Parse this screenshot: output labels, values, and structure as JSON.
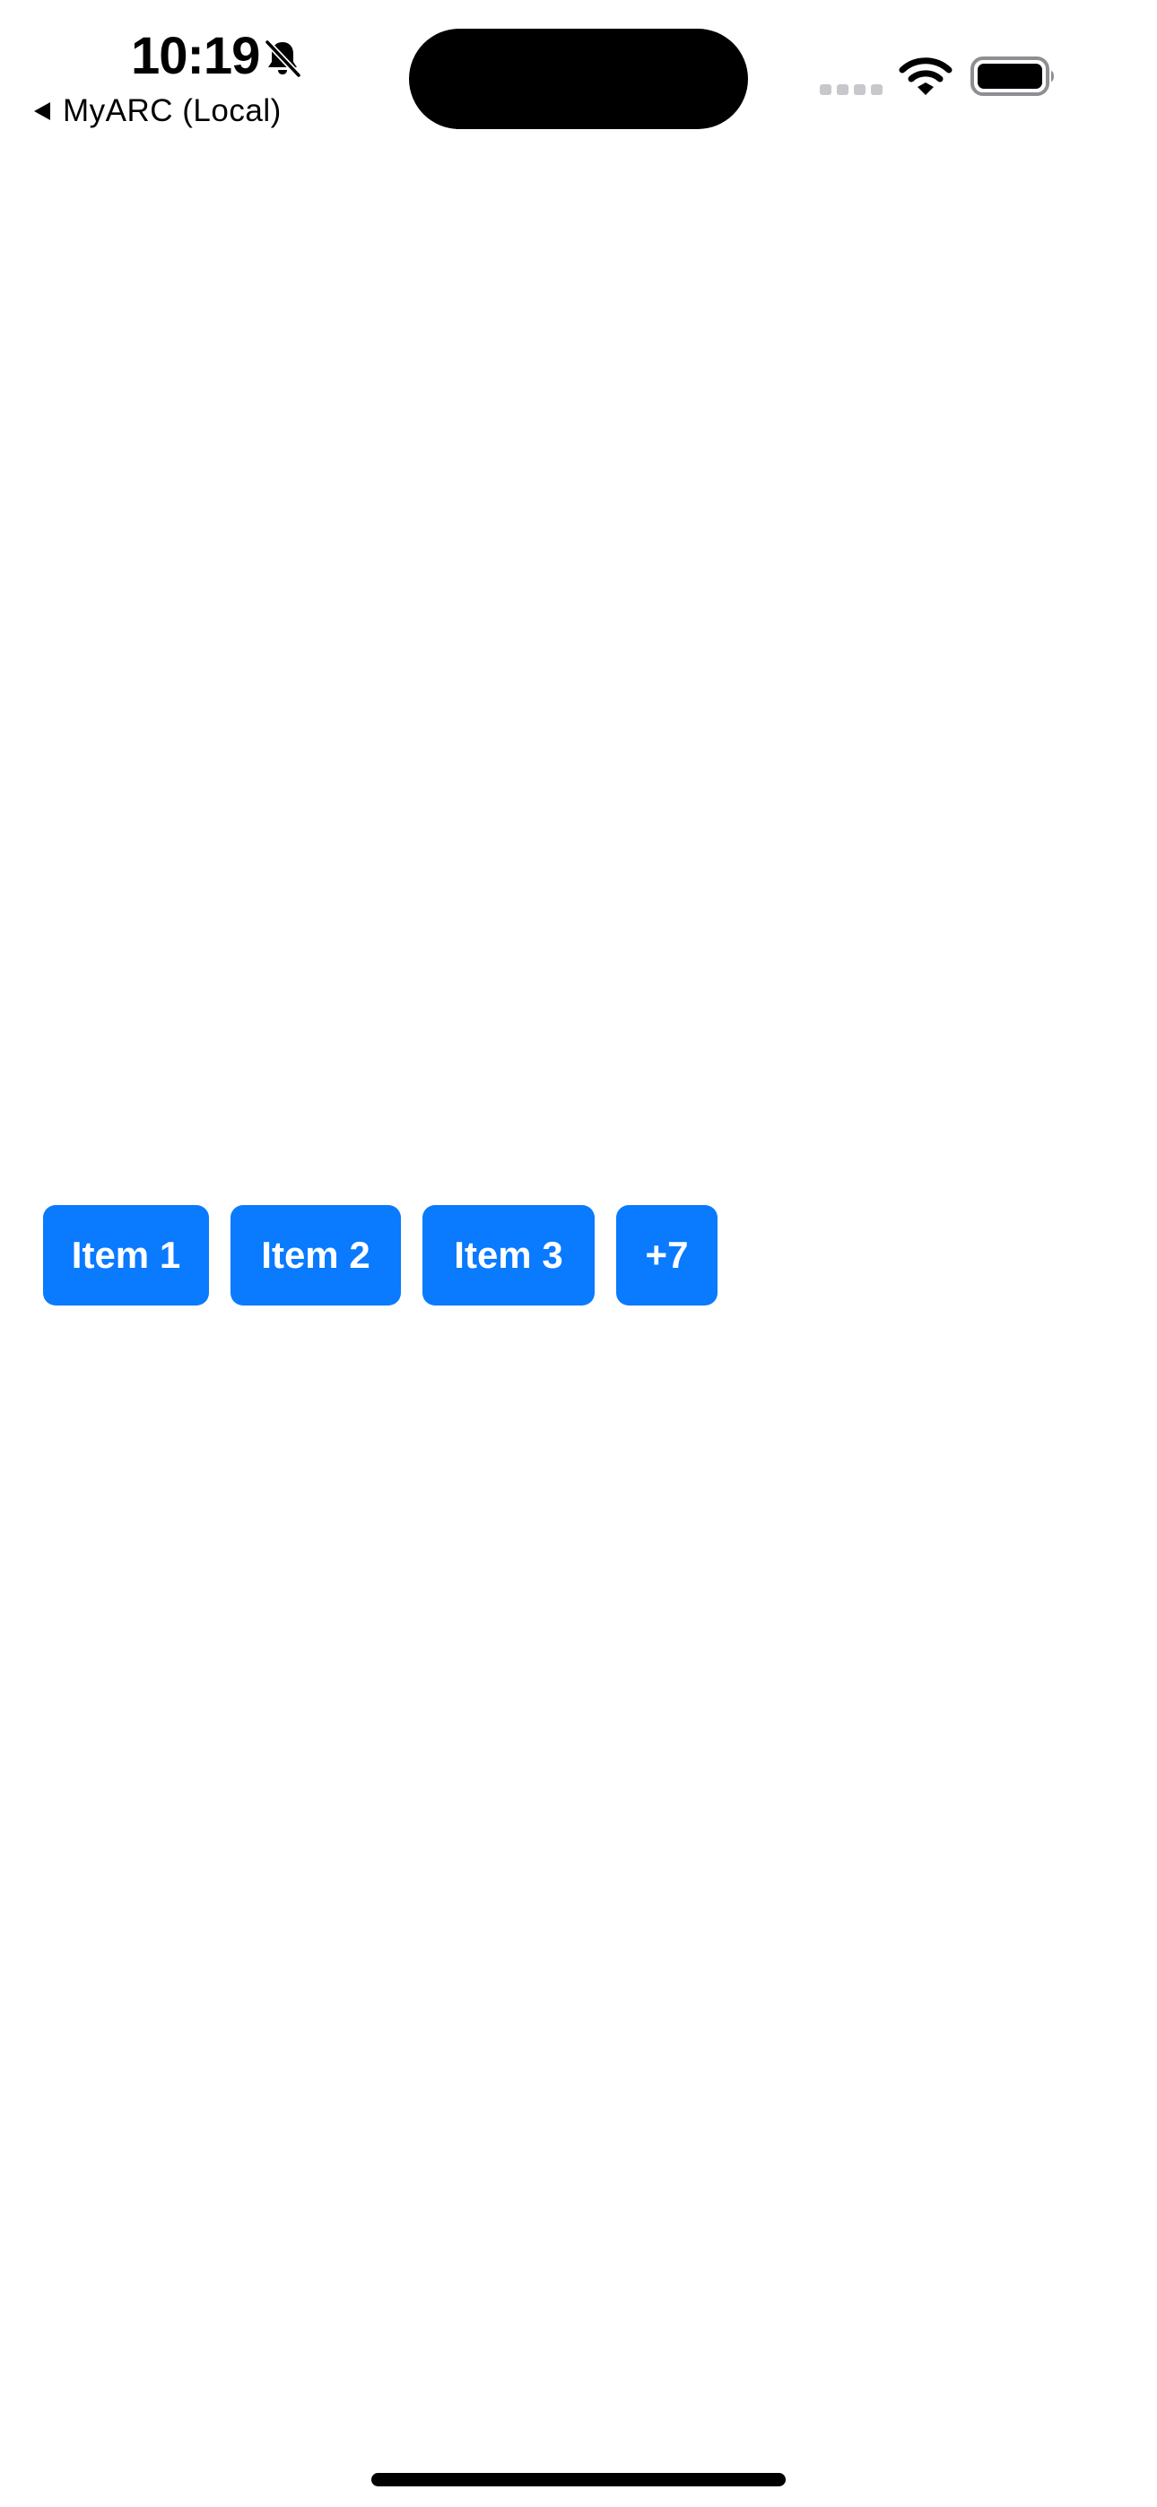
{
  "status_bar": {
    "time": "10:19",
    "back_app_label": "MyARC (Local)",
    "icons": [
      "bell-off-icon",
      "back-triangle-icon",
      "cell-signal-icon",
      "wifi-icon",
      "battery-icon"
    ]
  },
  "chips": {
    "items": [
      {
        "label": "Item 1"
      },
      {
        "label": "Item 2"
      },
      {
        "label": "Item 3"
      }
    ],
    "overflow_label": "+7"
  },
  "colors": {
    "chip_background": "#0a7aff",
    "chip_text": "#ffffff",
    "background": "#ffffff"
  }
}
